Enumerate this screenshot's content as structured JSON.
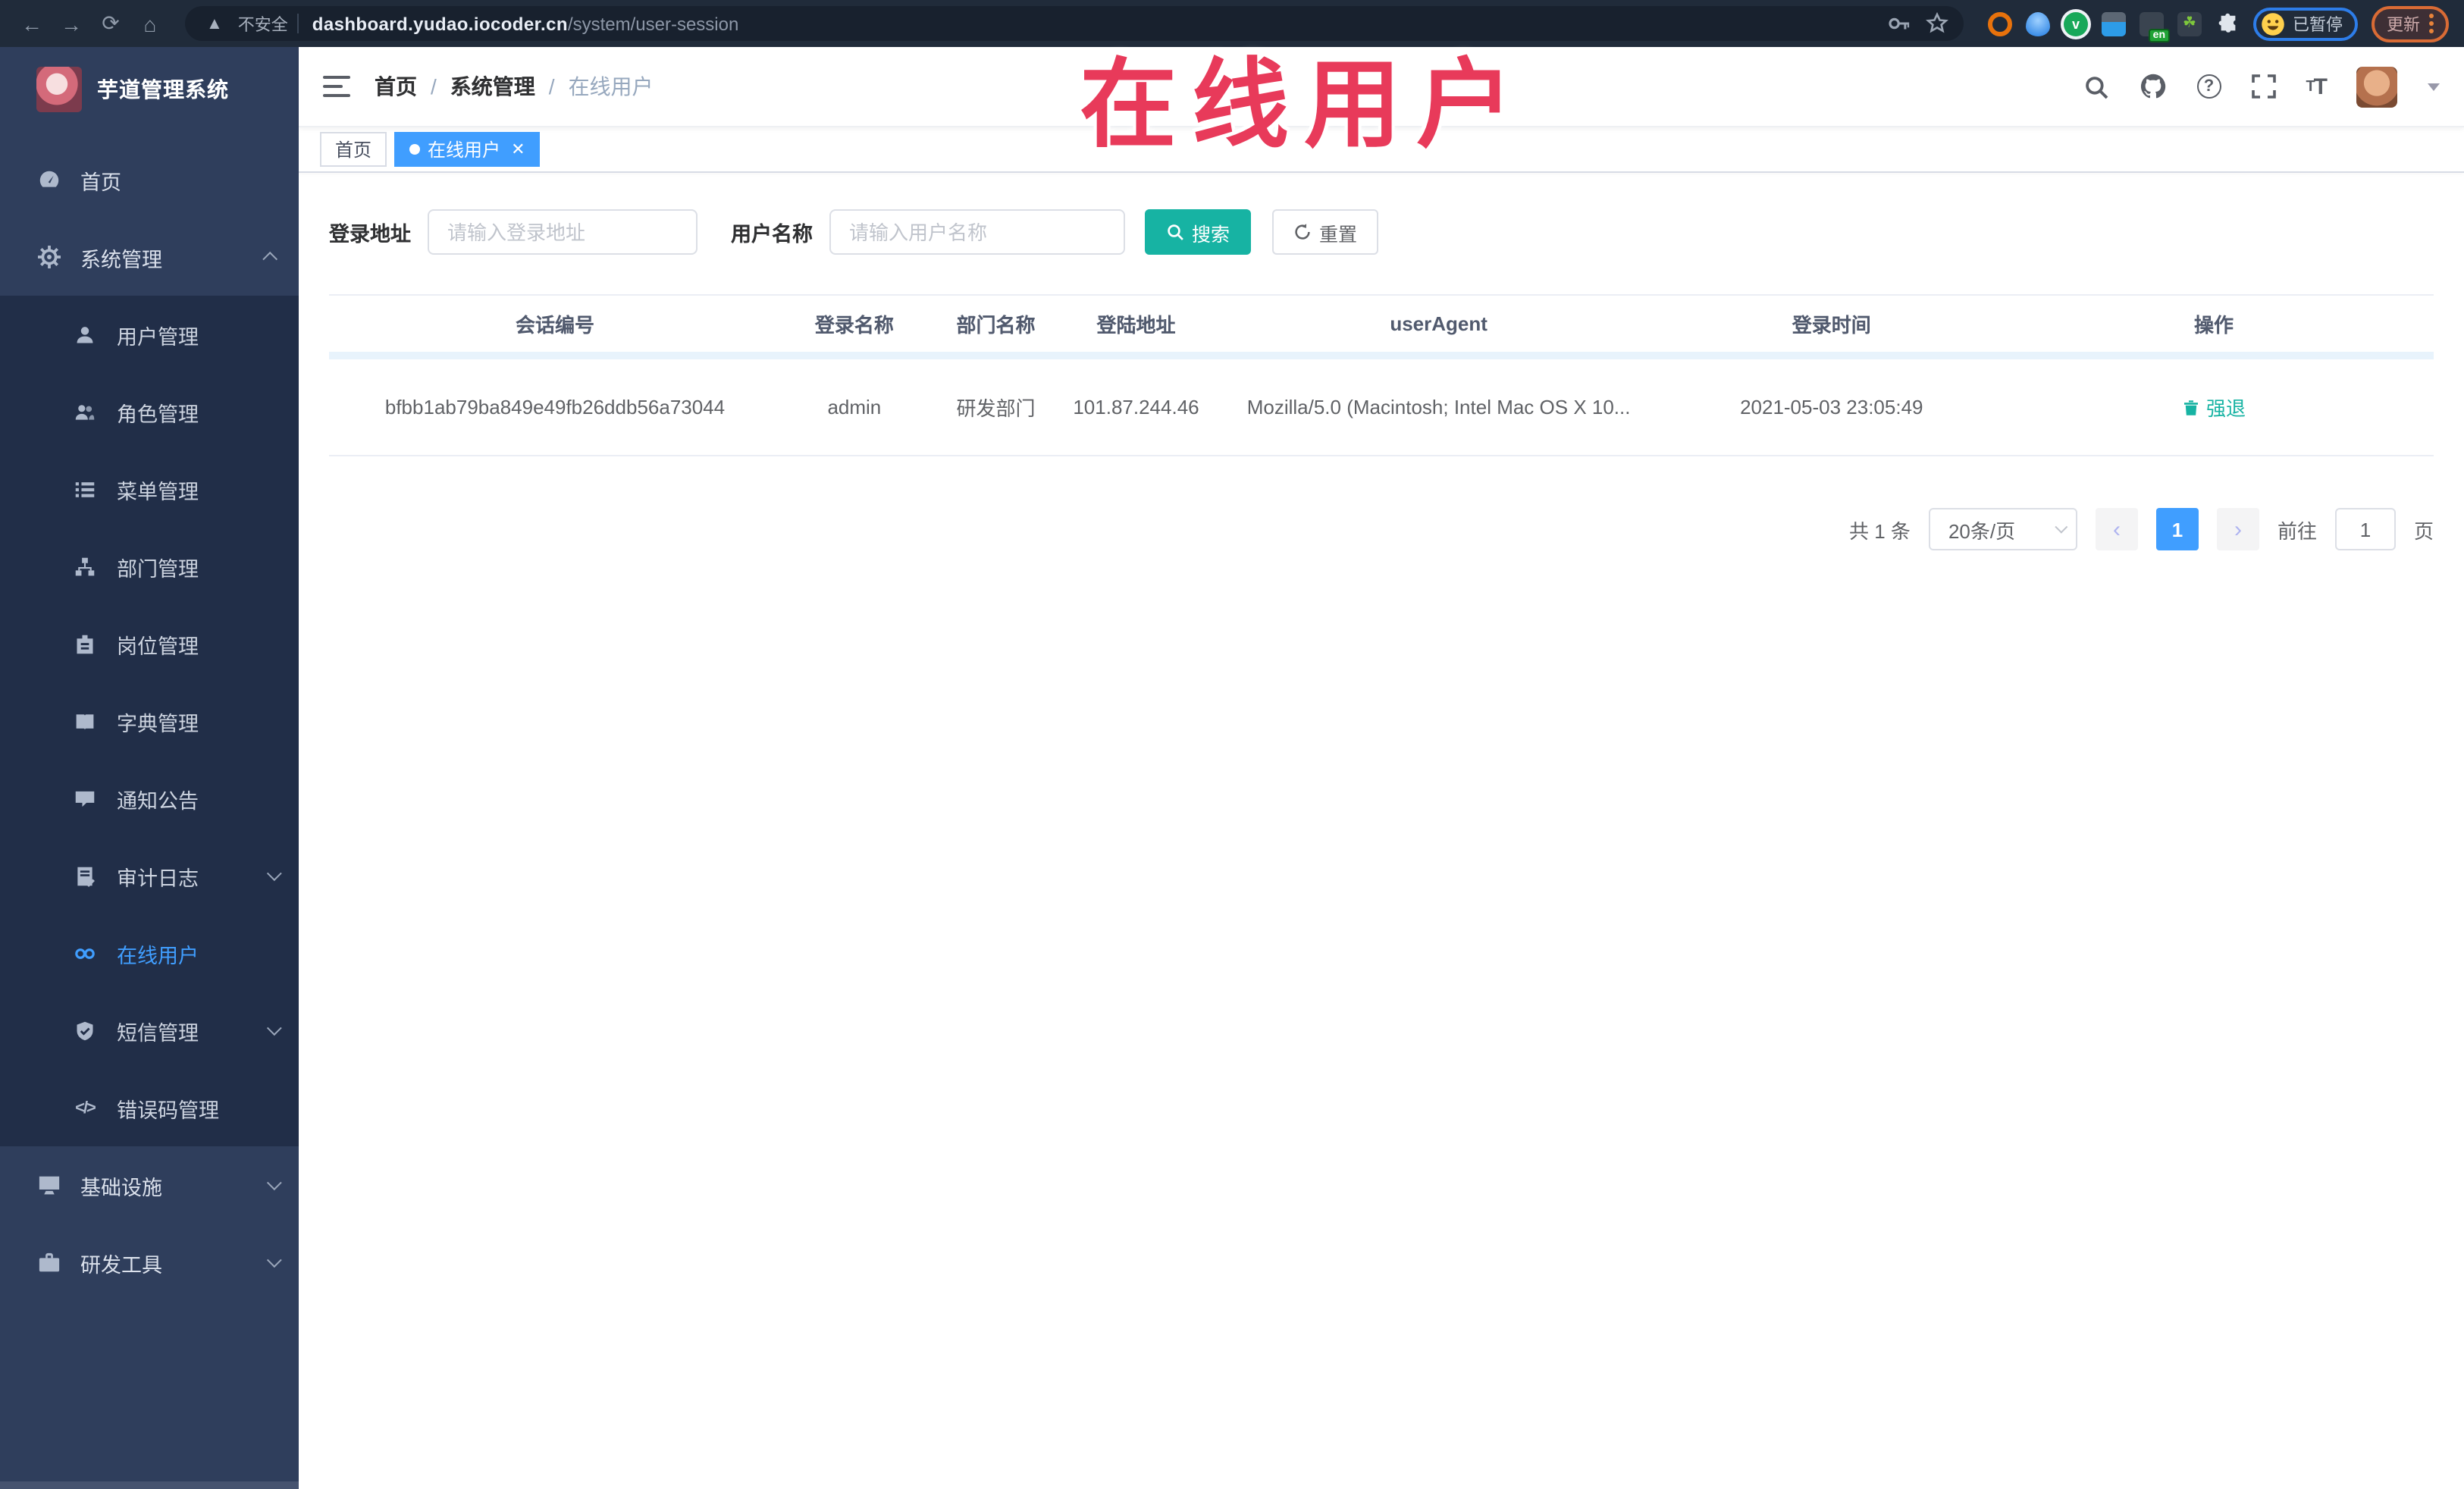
{
  "browser": {
    "security_warning": "不安全",
    "url_host": "dashboard.yudao.iocoder.cn",
    "url_path": "/system/user-session",
    "extension_en_badge": "en",
    "paused_badge": "已暂停",
    "update_button": "更新"
  },
  "overlay": {
    "annotation": "在线用户",
    "color": "#e83a5a"
  },
  "sidebar": {
    "logo_title": "芋道管理系统",
    "home": "首页",
    "system": "系统管理",
    "sub": {
      "user": "用户管理",
      "role": "角色管理",
      "menu": "菜单管理",
      "dept": "部门管理",
      "post": "岗位管理",
      "dict": "字典管理",
      "notice": "通知公告",
      "audit": "审计日志",
      "online": "在线用户",
      "sms": "短信管理",
      "errcode": "错误码管理"
    },
    "infra": "基础设施",
    "devtools": "研发工具"
  },
  "header": {
    "breadcrumb": [
      "首页",
      "系统管理",
      "在线用户"
    ]
  },
  "tabs": {
    "home": "首页",
    "active": "在线用户"
  },
  "filters": {
    "login_address_label": "登录地址",
    "login_address_placeholder": "请输入登录地址",
    "username_label": "用户名称",
    "username_placeholder": "请输入用户名称",
    "search": "搜索",
    "reset": "重置"
  },
  "table": {
    "columns": [
      "会话编号",
      "登录名称",
      "部门名称",
      "登陆地址",
      "userAgent",
      "登录时间",
      "操作"
    ],
    "rows": [
      {
        "session_id": "bfbb1ab79ba849e49fb26ddb56a73044",
        "username": "admin",
        "dept": "研发部门",
        "address": "101.87.244.46",
        "user_agent": "Mozilla/5.0 (Macintosh; Intel Mac OS X 10...",
        "login_time": "2021-05-03 23:05:49",
        "action": "强退"
      }
    ]
  },
  "pagination": {
    "total": "共 1 条",
    "page_size": "20条/页",
    "current_page": "1",
    "goto_label": "前往",
    "goto_value": "1",
    "goto_unit": "页"
  },
  "colors": {
    "accent_blue": "#409eff",
    "teal": "#17b3a3",
    "annotation_red": "#e83a5a",
    "sidebar_bg": "#2f3e5c",
    "submenu_bg": "#212e48",
    "browser_bar": "#202b3a"
  }
}
